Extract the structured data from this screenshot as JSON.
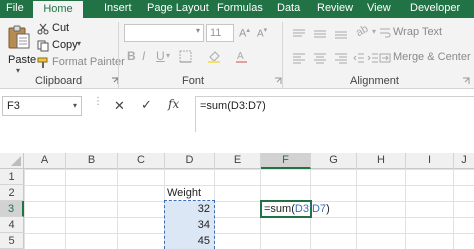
{
  "tabs": [
    "File",
    "Home",
    "Insert",
    "Page Layout",
    "Formulas",
    "Data",
    "Review",
    "View",
    "Developer"
  ],
  "active_tab": "Home",
  "ribbon": {
    "clipboard": {
      "paste_label": "Paste",
      "cut_label": "Cut",
      "copy_label": "Copy",
      "format_painter_label": "Format Painter",
      "group_label": "Clipboard"
    },
    "font": {
      "font_size": "11",
      "group_label": "Font",
      "bold": "B",
      "italic": "I",
      "underline": "U"
    },
    "alignment": {
      "wrap_text_label": "Wrap Text",
      "merge_center_label": "Merge & Center",
      "group_label": "Alignment"
    }
  },
  "formula_bar": {
    "name_box": "F3",
    "fx_label": "fx",
    "formula_prefix": "=sum(",
    "formula_ref": "D3:D7",
    "formula_suffix": ")"
  },
  "columns": [
    "A",
    "B",
    "C",
    "D",
    "E",
    "F",
    "G",
    "H",
    "I",
    "J"
  ],
  "rows": [
    "1",
    "2",
    "3",
    "4",
    "5"
  ],
  "selected_column": "F",
  "selected_row": "3",
  "cells": {
    "D2": "Weight",
    "D3": "32",
    "D4": "34",
    "D5": "45"
  },
  "active_cell_formula": {
    "prefix": "=sum(",
    "ref": "D3:D7",
    "suffix": ")"
  },
  "colors": {
    "excel_green": "#217346",
    "range_blue": "#3a6fb8",
    "range_fill": "#dbe7f5"
  }
}
